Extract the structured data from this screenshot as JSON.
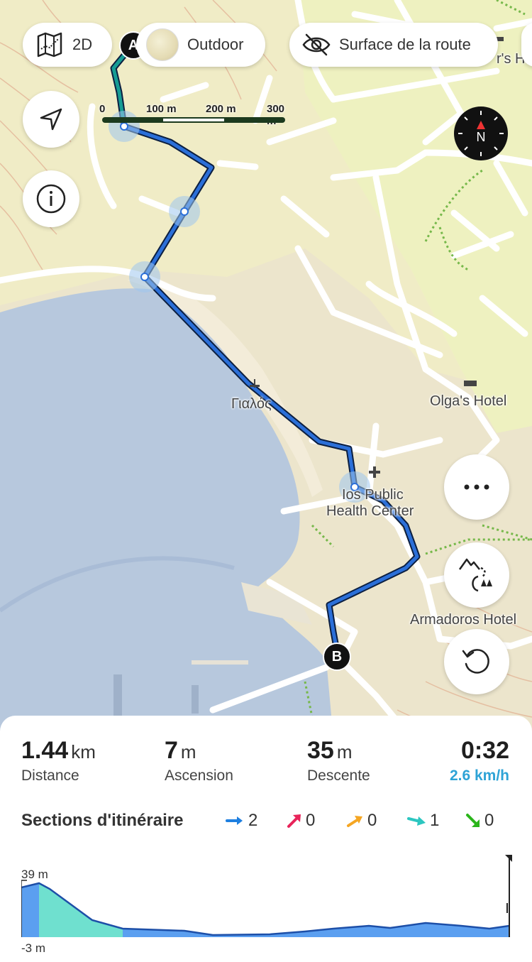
{
  "toolbar": {
    "mode_2d_label": "2D",
    "map_style_label": "Outdoor",
    "surface_label": "Surface de la route"
  },
  "scale": {
    "labels": [
      "0",
      "100 m",
      "200 m",
      "300 m"
    ]
  },
  "compass": {
    "label": "N"
  },
  "markers": {
    "start": "A",
    "end": "B"
  },
  "map_labels": {
    "beach": "Γιαλός",
    "health_center_line1": "Ios Public",
    "health_center_line2": "Health Center",
    "olga_hotel": "Olga's Hotel",
    "armadoros_hotel": "Armadoros Hotel",
    "cut_hotel": "r's H"
  },
  "stats": {
    "distance": {
      "value": "1.44",
      "unit": "km",
      "label": "Distance"
    },
    "ascent": {
      "value": "7",
      "unit": "m",
      "label": "Ascension"
    },
    "descent": {
      "value": "35",
      "unit": "m",
      "label": "Descente"
    },
    "duration": {
      "value": "0:32",
      "speed": "2.6 km/h"
    }
  },
  "sections": {
    "title": "Sections d'itinéraire",
    "items": [
      {
        "icon": "arrow-right-icon",
        "color": "#1e7fe0",
        "count": "2"
      },
      {
        "icon": "arrow-up-right-steep-icon",
        "color": "#e8245a",
        "count": "0"
      },
      {
        "icon": "arrow-up-right-icon",
        "color": "#f5a623",
        "count": "0"
      },
      {
        "icon": "arrow-right-down-slight-icon",
        "color": "#2cc6c0",
        "count": "1"
      },
      {
        "icon": "arrow-down-right-icon",
        "color": "#2bb51b",
        "count": "0"
      }
    ]
  },
  "elevation": {
    "max_label": "39 m",
    "min_label": "-3 m",
    "colors": {
      "flat": "#5b9ff0",
      "descent": "#6fe0cf"
    }
  },
  "colors": {
    "route": "#1d4fa8",
    "route_alt": "#169c94",
    "accent_speed": "#2ea3d6"
  }
}
